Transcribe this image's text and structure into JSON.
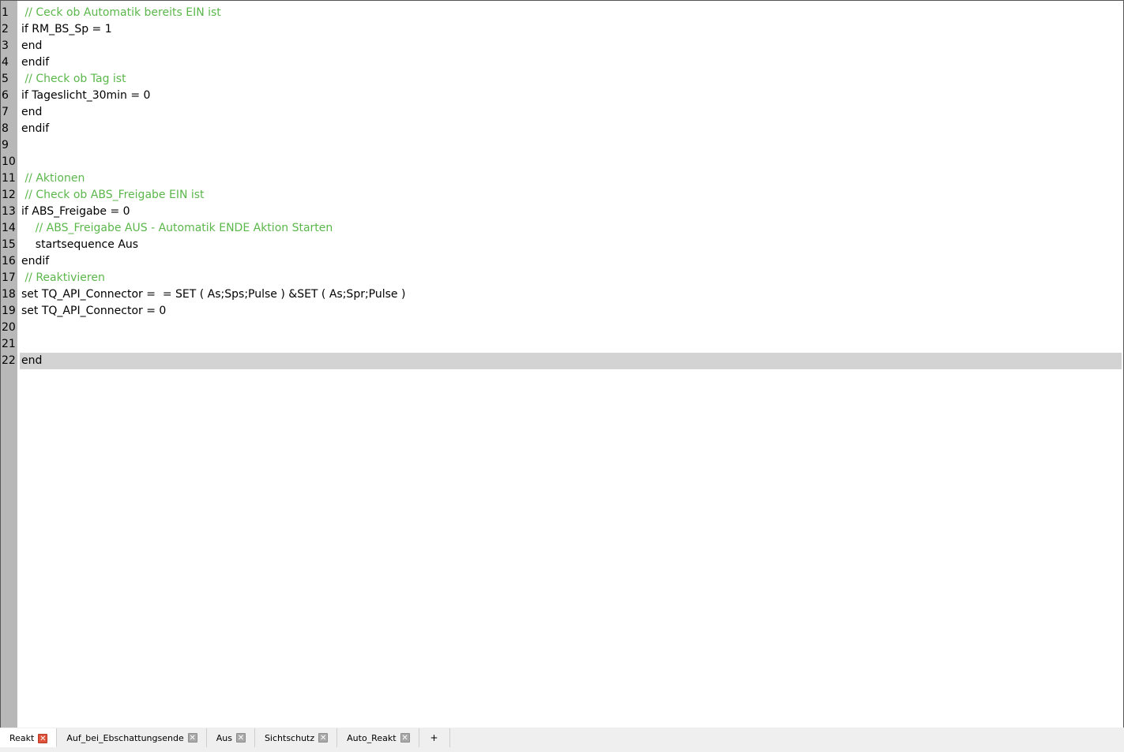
{
  "editor": {
    "lines": [
      {
        "num": "1",
        "text": " // Ceck ob Automatik bereits EIN ist",
        "comment": true
      },
      {
        "num": "2",
        "text": "if RM_BS_Sp = 1",
        "comment": false
      },
      {
        "num": "3",
        "text": "end",
        "comment": false
      },
      {
        "num": "4",
        "text": "endif",
        "comment": false
      },
      {
        "num": "5",
        "text": " // Check ob Tag ist",
        "comment": true
      },
      {
        "num": "6",
        "text": "if Tageslicht_30min = 0",
        "comment": false
      },
      {
        "num": "7",
        "text": "end",
        "comment": false
      },
      {
        "num": "8",
        "text": "endif",
        "comment": false
      },
      {
        "num": "9",
        "text": "",
        "comment": false
      },
      {
        "num": "10",
        "text": "",
        "comment": false
      },
      {
        "num": "11",
        "text": " // Aktionen",
        "comment": true
      },
      {
        "num": "12",
        "text": " // Check ob ABS_Freigabe EIN ist",
        "comment": true
      },
      {
        "num": "13",
        "text": "if ABS_Freigabe = 0",
        "comment": false
      },
      {
        "num": "14",
        "text": "    // ABS_Freigabe AUS - Automatik ENDE Aktion Starten",
        "comment": true
      },
      {
        "num": "15",
        "text": "    startsequence Aus",
        "comment": false
      },
      {
        "num": "16",
        "text": "endif",
        "comment": false
      },
      {
        "num": "17",
        "text": " // Reaktivieren",
        "comment": true
      },
      {
        "num": "18",
        "text": "set TQ_API_Connector =  = SET ( As;Sps;Pulse ) &SET ( As;Spr;Pulse )",
        "comment": false
      },
      {
        "num": "19",
        "text": "set TQ_API_Connector = 0",
        "comment": false
      },
      {
        "num": "20",
        "text": "",
        "comment": false
      },
      {
        "num": "21",
        "text": "",
        "comment": false
      },
      {
        "num": "22",
        "text": "end",
        "comment": false,
        "current": true
      }
    ]
  },
  "tabs": [
    {
      "label": "Reakt",
      "active": true
    },
    {
      "label": "Auf_bei_Ebschattungsende",
      "active": false
    },
    {
      "label": "Aus",
      "active": false
    },
    {
      "label": "Sichtschutz",
      "active": false
    },
    {
      "label": "Auto_Reakt",
      "active": false
    }
  ],
  "add_tab_label": "+",
  "close_glyph": "✕",
  "colors": {
    "comment": "#5bb74b",
    "gutter": "#b8b8b8",
    "current_line": "#d3d3d3",
    "active_close": "#e0523a"
  }
}
